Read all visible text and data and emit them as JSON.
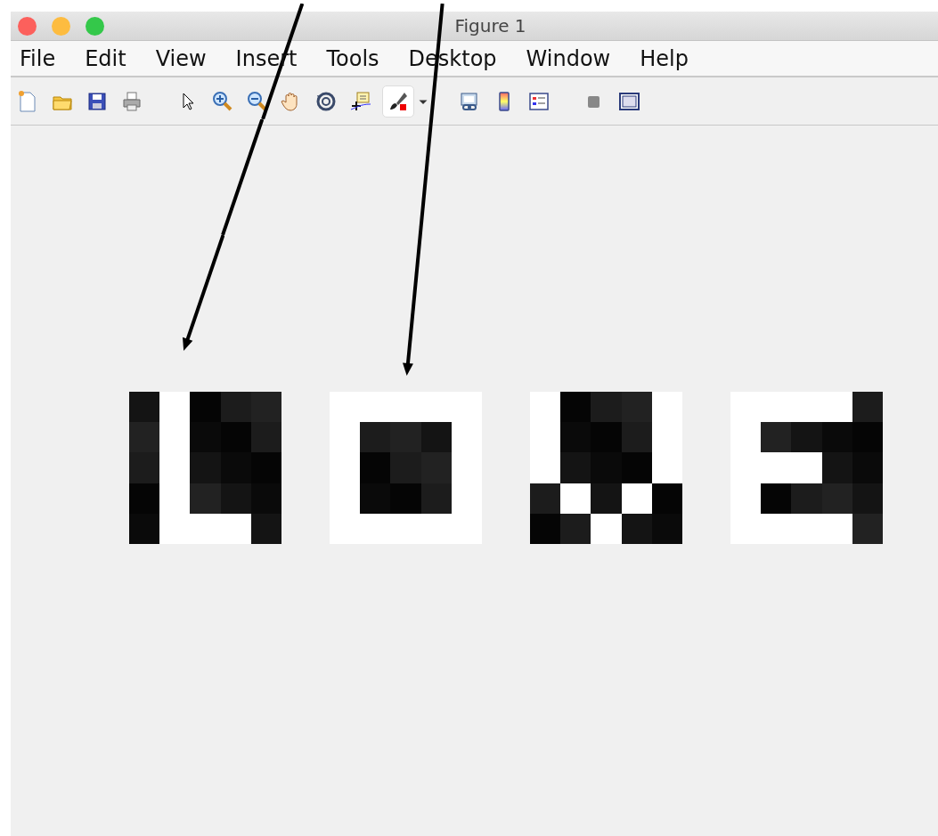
{
  "window": {
    "title": "Figure 1"
  },
  "menu": [
    "File",
    "Edit",
    "View",
    "Insert",
    "Tools",
    "Desktop",
    "Window",
    "Help"
  ],
  "images": [
    {
      "pattern": [
        [
          true,
          false,
          true,
          true,
          true
        ],
        [
          true,
          false,
          true,
          true,
          true
        ],
        [
          true,
          false,
          true,
          true,
          true
        ],
        [
          true,
          false,
          true,
          true,
          true
        ],
        [
          true,
          false,
          false,
          false,
          true
        ]
      ]
    },
    {
      "pattern": [
        [
          false,
          false,
          false,
          false,
          false
        ],
        [
          false,
          true,
          true,
          true,
          false
        ],
        [
          false,
          true,
          true,
          true,
          false
        ],
        [
          false,
          true,
          true,
          true,
          false
        ],
        [
          false,
          false,
          false,
          false,
          false
        ]
      ]
    },
    {
      "pattern": [
        [
          false,
          true,
          true,
          true,
          false
        ],
        [
          false,
          true,
          true,
          true,
          false
        ],
        [
          false,
          true,
          true,
          true,
          false
        ],
        [
          true,
          false,
          true,
          false,
          true
        ],
        [
          true,
          true,
          false,
          true,
          true
        ]
      ]
    },
    {
      "pattern": [
        [
          false,
          false,
          false,
          false,
          true
        ],
        [
          false,
          true,
          true,
          true,
          true
        ],
        [
          false,
          false,
          false,
          true,
          true
        ],
        [
          false,
          true,
          true,
          true,
          true
        ],
        [
          false,
          false,
          false,
          false,
          true
        ]
      ]
    }
  ]
}
